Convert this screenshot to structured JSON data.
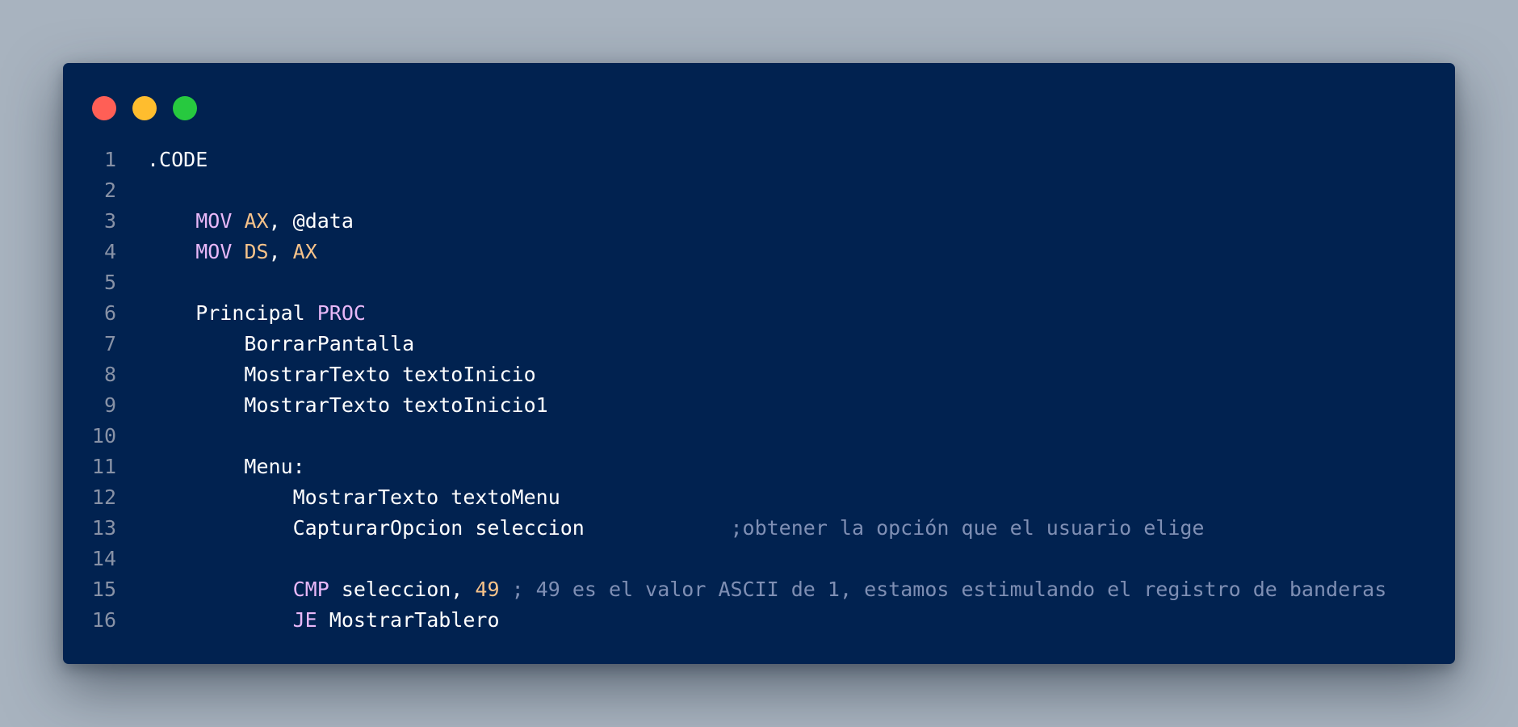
{
  "window": {
    "background": "#012250",
    "controls": [
      {
        "name": "close",
        "color": "#ff5f56"
      },
      {
        "name": "minimize",
        "color": "#ffbd2e"
      },
      {
        "name": "maximize",
        "color": "#27c93f"
      }
    ]
  },
  "colors": {
    "keyword": "#e8b8f8",
    "register": "#f7c38a",
    "number": "#f7c38a",
    "comment": "#7f8fb4",
    "text": "#ffffff",
    "line_number": "#8892a6"
  },
  "code": {
    "lines": [
      {
        "n": "1",
        "tokens": [
          {
            "t": ".CODE",
            "c": "tx"
          }
        ]
      },
      {
        "n": "2",
        "tokens": []
      },
      {
        "n": "3",
        "tokens": [
          {
            "t": "    ",
            "c": "tx"
          },
          {
            "t": "MOV",
            "c": "kw"
          },
          {
            "t": " ",
            "c": "tx"
          },
          {
            "t": "AX",
            "c": "reg"
          },
          {
            "t": ", @data",
            "c": "tx"
          }
        ]
      },
      {
        "n": "4",
        "tokens": [
          {
            "t": "    ",
            "c": "tx"
          },
          {
            "t": "MOV",
            "c": "kw"
          },
          {
            "t": " ",
            "c": "tx"
          },
          {
            "t": "DS",
            "c": "reg"
          },
          {
            "t": ", ",
            "c": "tx"
          },
          {
            "t": "AX",
            "c": "reg"
          }
        ]
      },
      {
        "n": "5",
        "tokens": []
      },
      {
        "n": "6",
        "tokens": [
          {
            "t": "    Principal ",
            "c": "tx"
          },
          {
            "t": "PROC",
            "c": "kw"
          }
        ]
      },
      {
        "n": "7",
        "tokens": [
          {
            "t": "        BorrarPantalla",
            "c": "tx"
          }
        ]
      },
      {
        "n": "8",
        "tokens": [
          {
            "t": "        MostrarTexto textoInicio",
            "c": "tx"
          }
        ]
      },
      {
        "n": "9",
        "tokens": [
          {
            "t": "        MostrarTexto textoInicio1",
            "c": "tx"
          }
        ]
      },
      {
        "n": "10",
        "tokens": []
      },
      {
        "n": "11",
        "tokens": [
          {
            "t": "        Menu:",
            "c": "tx"
          }
        ]
      },
      {
        "n": "12",
        "tokens": [
          {
            "t": "            MostrarTexto textoMenu",
            "c": "tx"
          }
        ]
      },
      {
        "n": "13",
        "tokens": [
          {
            "t": "            CapturarOpcion seleccion            ",
            "c": "tx"
          },
          {
            "t": ";obtener la opción que el usuario elige",
            "c": "cm"
          }
        ]
      },
      {
        "n": "14",
        "tokens": []
      },
      {
        "n": "15",
        "tokens": [
          {
            "t": "            ",
            "c": "tx"
          },
          {
            "t": "CMP",
            "c": "kw"
          },
          {
            "t": " seleccion, ",
            "c": "tx"
          },
          {
            "t": "49",
            "c": "num"
          },
          {
            "t": " ",
            "c": "tx"
          },
          {
            "t": "; 49 es el valor ASCII de 1, estamos estimulando el registro de banderas",
            "c": "cm"
          }
        ]
      },
      {
        "n": "16",
        "tokens": [
          {
            "t": "            ",
            "c": "tx"
          },
          {
            "t": "JE",
            "c": "kw"
          },
          {
            "t": " MostrarTablero",
            "c": "tx"
          }
        ]
      }
    ]
  }
}
